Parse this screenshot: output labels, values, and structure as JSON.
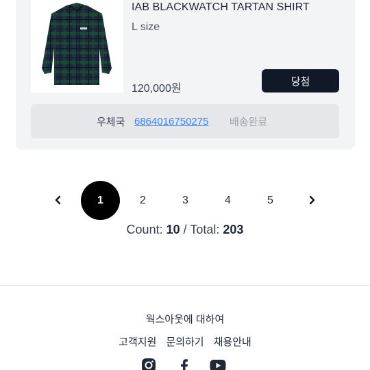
{
  "product": {
    "name": "IAB BLACKWATCH TARTAN SHIRT",
    "size": "L size",
    "price": "120,000원",
    "win_label": "당첨"
  },
  "shipping": {
    "carrier": "우체국",
    "tracking_number": "6864016750275",
    "status": "배송완료"
  },
  "pagination": {
    "pages": [
      "1",
      "2",
      "3",
      "4",
      "5"
    ],
    "current": "1",
    "count_label": "Count:",
    "count": "10",
    "separator": "/",
    "total_label": "Total:",
    "total": "203"
  },
  "footer": {
    "about": "웍스아웃에 대하여",
    "links": [
      "고객지원",
      "문의하기",
      "채용안내"
    ],
    "social_icons": [
      "instagram-icon",
      "facebook-icon",
      "youtube-icon"
    ]
  },
  "colors": {
    "card_bg": "#f3f4f6",
    "button_bg": "#111827",
    "link": "#3b82f6",
    "active_page": "#000000"
  }
}
